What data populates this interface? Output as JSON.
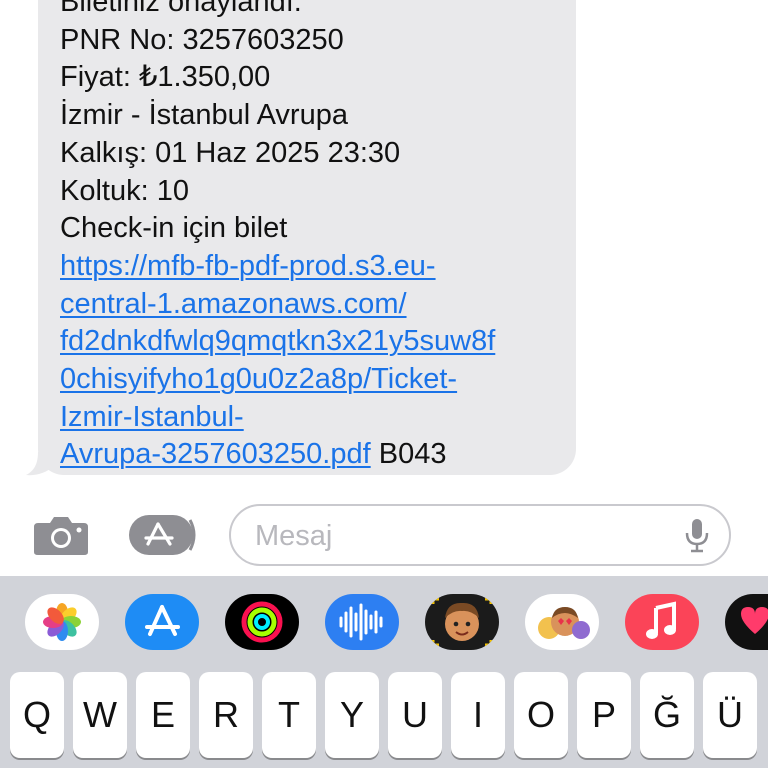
{
  "message": {
    "partial_top": "Biletiniz onaylandı.",
    "pnr": "PNR No: 3257603250",
    "price": "Fiyat: ₺1.350,00",
    "route": "İzmir - İstanbul Avrupa",
    "departure": "Kalkış: 01 Haz 2025 23:30",
    "seat": "Koltuk: 10",
    "checkin": "Check-in için bilet",
    "link_lines": [
      "https://mfb-fb-pdf-prod.s3.eu-",
      "central-1.amazonaws.com/",
      "fd2dnkdfwlq9qmqtkn3x21y5suw8f",
      "0chisyifyho1g0u0z2a8p/Ticket-",
      "Izmir-Istanbul-",
      "Avrupa-3257603250.pdf"
    ],
    "suffix": " B043"
  },
  "input_bar": {
    "placeholder": "Mesaj",
    "value": ""
  },
  "app_strip": [
    {
      "name": "photos-app-icon",
      "color": "#ffffff"
    },
    {
      "name": "app-store-app-icon",
      "color": "#1e8cf5"
    },
    {
      "name": "fitness-app-icon",
      "color": "#000000"
    },
    {
      "name": "audio-message-app-icon",
      "color": "#2d7ff2"
    },
    {
      "name": "memoji-app-icon",
      "color": "#1b1b1b"
    },
    {
      "name": "memoji-stickers-app-icon",
      "color": "#ffffff"
    },
    {
      "name": "music-app-icon",
      "color": "#fb4458"
    },
    {
      "name": "digital-touch-app-icon",
      "color": "#111111"
    }
  ],
  "keyboard": {
    "row1": [
      "Q",
      "W",
      "E",
      "R",
      "T",
      "Y",
      "U",
      "I",
      "O",
      "P",
      "Ğ",
      "Ü"
    ]
  },
  "colors": {
    "bubble": "#e9e9eb",
    "link": "#1a73e8",
    "keyboard_bg": "#d1d3d9"
  }
}
